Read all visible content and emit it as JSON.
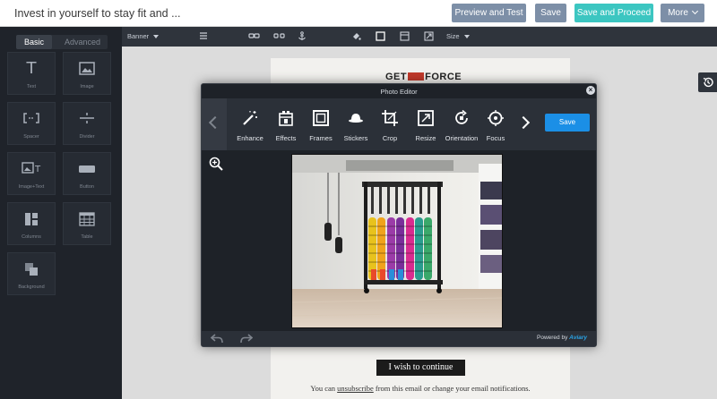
{
  "header": {
    "title": "Invest in yourself to stay fit and ...",
    "preview_label": "Preview and Test",
    "save_label": "Save",
    "proceed_label": "Save and Proceed",
    "more_label": "More"
  },
  "sidebar": {
    "tabs": [
      {
        "label": "Basic",
        "active": true
      },
      {
        "label": "Advanced",
        "active": false
      }
    ],
    "tiles": [
      {
        "label": "Text",
        "icon": "text-icon"
      },
      {
        "label": "Image",
        "icon": "image-icon"
      },
      {
        "label": "Spacer",
        "icon": "spacer-icon"
      },
      {
        "label": "Divider",
        "icon": "divider-icon"
      },
      {
        "label": "Image+Text",
        "icon": "image-text-icon"
      },
      {
        "label": "Button",
        "icon": "button-icon"
      },
      {
        "label": "Columns",
        "icon": "columns-icon"
      },
      {
        "label": "Table",
        "icon": "table-icon"
      },
      {
        "label": "Background",
        "icon": "background-icon"
      }
    ]
  },
  "toolbar": {
    "banner_label": "Banner",
    "size_label": "Size"
  },
  "email": {
    "logo_left": "GET",
    "logo_right": "FORCE",
    "cta_label": "I wish to continue",
    "unsub_prefix": "You can ",
    "unsub_link": "unsubscribe",
    "unsub_suffix": " from this email or change your email notifications."
  },
  "editor": {
    "title": "Photo Editor",
    "tools": [
      {
        "label": "Enhance",
        "icon": "magic-wand-icon"
      },
      {
        "label": "Effects",
        "icon": "effects-icon"
      },
      {
        "label": "Frames",
        "icon": "frame-icon"
      },
      {
        "label": "Stickers",
        "icon": "hat-icon"
      },
      {
        "label": "Crop",
        "icon": "crop-icon"
      },
      {
        "label": "Resize",
        "icon": "resize-icon"
      },
      {
        "label": "Orientation",
        "icon": "rotate-icon"
      },
      {
        "label": "Focus",
        "icon": "focus-icon"
      }
    ],
    "save_label": "Save",
    "powered_prefix": "Powered by",
    "powered_brand": "Aviary"
  },
  "colors": {
    "accent_teal": "#3cc6c1",
    "accent_blue": "#1b8fe6",
    "button_gray": "#7d8fa7"
  }
}
